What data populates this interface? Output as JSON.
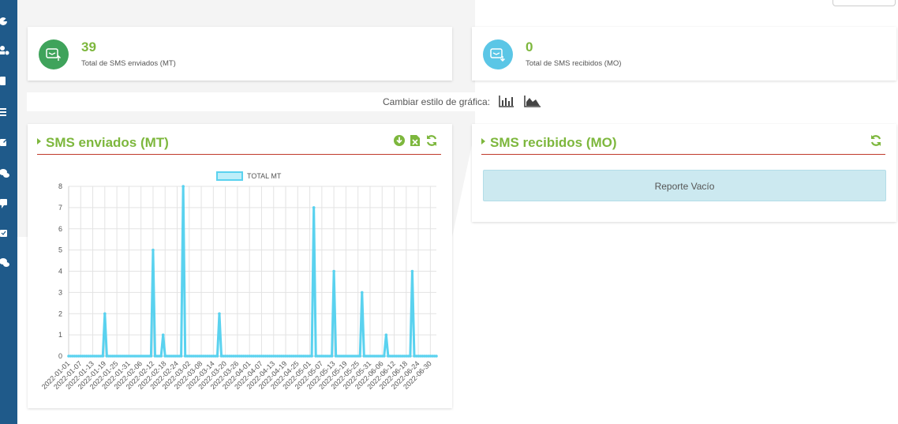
{
  "sidebar": {
    "icons": [
      "pie-chart-icon",
      "users-cog-icon",
      "clipboard-icon",
      "list-icon",
      "edit-icon",
      "comments-icon",
      "comment-icon",
      "envelope-check-icon",
      "chat-icon"
    ]
  },
  "stats": {
    "sent": {
      "value": "39",
      "label": "Total de SMS enviados (MT)",
      "color": "#3fa35b"
    },
    "received": {
      "value": "0",
      "label": "Total de SMS recibidos (MO)",
      "color": "#5bc6e6"
    }
  },
  "toolbar": {
    "change_chart_label": "Cambiar estilo de gráfica:",
    "bar_chart_icon": "bar-chart-icon",
    "area_chart_icon": "area-chart-icon"
  },
  "sent_panel": {
    "title": "SMS enviados (MT)",
    "icons": [
      "download-icon",
      "excel-file-icon",
      "refresh-icon"
    ]
  },
  "received_panel": {
    "title": "SMS recibidos (MO)",
    "empty_message": "Reporte Vacío",
    "icons": [
      "refresh-icon"
    ]
  },
  "colors": {
    "accent_green": "#7db73d",
    "rule_red": "#c0392b",
    "line_cyan": "#5ad2ef",
    "sidebar_blue": "#1f5a8a"
  },
  "chart_data": {
    "type": "line",
    "legend": "TOTAL MT",
    "legend_position": "top-center",
    "grid": true,
    "ylim": [
      0,
      8
    ],
    "yticks": [
      0,
      1,
      2,
      3,
      4,
      5,
      6,
      7,
      8
    ],
    "xtick_labels": [
      "2022-01-01",
      "2022-01-07",
      "2022-01-13",
      "2022-01-19",
      "2022-01-25",
      "2022-01-31",
      "2022-02-06",
      "2022-02-12",
      "2022-02-18",
      "2022-02-24",
      "2022-03-02",
      "2022-03-08",
      "2022-03-14",
      "2022-03-20",
      "2022-03-26",
      "2022-04-01",
      "2022-04-07",
      "2022-04-13",
      "2022-04-19",
      "2022-04-25",
      "2022-05-01",
      "2022-05-07",
      "2022-05-13",
      "2022-05-19",
      "2022-05-25",
      "2022-05-31",
      "2022-06-06",
      "2022-06-12",
      "2022-06-18",
      "2022-06-24",
      "2022-06-30"
    ],
    "series": [
      {
        "name": "TOTAL MT",
        "start": "2022-01-01",
        "end": "2022-07-03",
        "nonzero": [
          {
            "date": "2022-01-19",
            "value": 2
          },
          {
            "date": "2022-02-12",
            "value": 5
          },
          {
            "date": "2022-02-17",
            "value": 1
          },
          {
            "date": "2022-02-27",
            "value": 8
          },
          {
            "date": "2022-03-17",
            "value": 2
          },
          {
            "date": "2022-05-03",
            "value": 7
          },
          {
            "date": "2022-05-13",
            "value": 4
          },
          {
            "date": "2022-05-27",
            "value": 3
          },
          {
            "date": "2022-06-08",
            "value": 1
          },
          {
            "date": "2022-06-21",
            "value": 4
          }
        ]
      }
    ]
  }
}
